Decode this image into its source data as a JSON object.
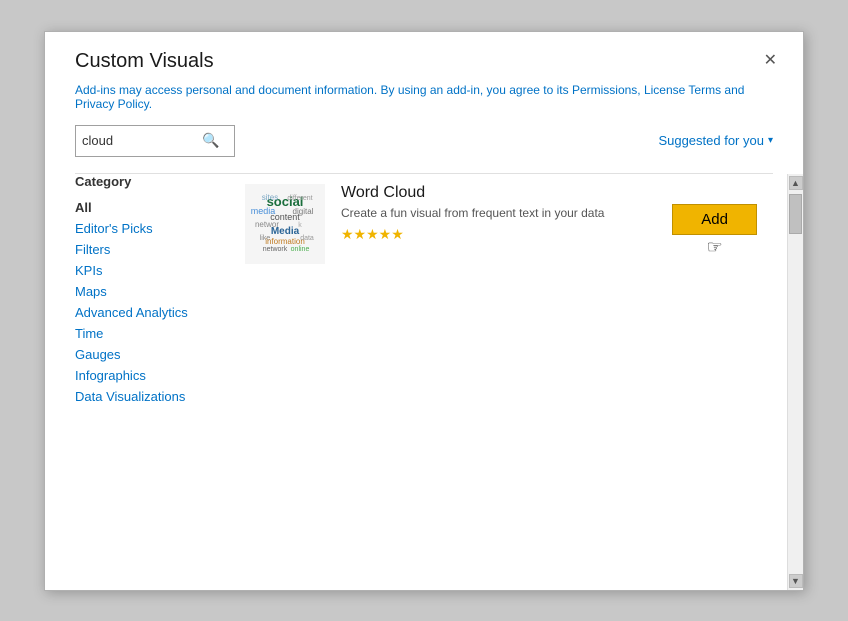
{
  "dialog": {
    "title": "Custom Visuals",
    "close_label": "✕"
  },
  "info": {
    "text": "Add-ins may access personal and document information. By using an add-in, you agree to its Permissions, License Terms and Privacy Policy."
  },
  "search": {
    "value": "cloud",
    "placeholder": "cloud",
    "icon": "🔍"
  },
  "suggested": {
    "label": "Suggested for you",
    "chevron": "▾"
  },
  "sidebar": {
    "category_label": "Category",
    "items": [
      {
        "label": "All",
        "active": true
      },
      {
        "label": "Editor's Picks",
        "active": false
      },
      {
        "label": "Filters",
        "active": false
      },
      {
        "label": "KPIs",
        "active": false
      },
      {
        "label": "Maps",
        "active": false
      },
      {
        "label": "Advanced Analytics",
        "active": false
      },
      {
        "label": "Time",
        "active": false
      },
      {
        "label": "Gauges",
        "active": false
      },
      {
        "label": "Infographics",
        "active": false
      },
      {
        "label": "Data Visualizations",
        "active": false
      }
    ]
  },
  "visual": {
    "title": "Word Cloud",
    "description": "Create a fun visual from frequent text in your data",
    "stars": "★★★★★",
    "add_label": "Add"
  }
}
